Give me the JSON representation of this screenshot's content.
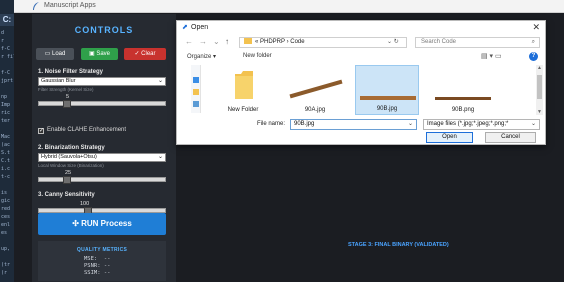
{
  "code_strip": {
    "tab_label": "C:",
    "lines": [
      "d",
      "r",
      "f-C",
      "r fil",
      "",
      "f-C",
      "jprt",
      "",
      "np",
      "Imp",
      "ric",
      "ter",
      "",
      "Mac",
      "(ac",
      "S.t",
      "C.t",
      "i.c",
      "t-c",
      "",
      "is",
      "gic",
      "red",
      "ces",
      "enl",
      "es",
      "",
      "up,",
      "",
      "(tr",
      "(r"
    ]
  },
  "app": {
    "title": "Manuscript Apps",
    "sidebar": {
      "heading": "CONTROLS",
      "buttons": {
        "load": "Load",
        "save": "Save",
        "clear": "Clear"
      },
      "noise": {
        "heading": "1. Noise Filter Strategy",
        "selected": "Gaussian Blur",
        "hint": "Filter Strength (Kernel Size)",
        "value": "5",
        "slider_fraction": 0.2
      },
      "clahe_label": "Enable CLAHE Enhancement",
      "binarization": {
        "heading": "2. Binarization Strategy",
        "selected": "Hybrid (Sauvola+Otsu)",
        "hint": "Local Window Size (Binarization)",
        "value": "25",
        "slider_fraction": 0.2
      },
      "canny": {
        "heading": "3. Canny Sensitivity",
        "value": "100",
        "slider_fraction": 0.38
      },
      "run_label": "RUN Process",
      "metrics": {
        "title": "QUALITY METRICS",
        "mse": "MSE:  --",
        "psnr": "PSNR: --",
        "ssim": "SSIM: --"
      }
    },
    "stage_label": "STAGE 3: FINAL BINARY (VALIDATED)"
  },
  "dialog": {
    "title": "Open",
    "breadcrumb": "«  PHDPRP  ›  Code",
    "search_placeholder": "Search Code",
    "organize": "Organize ▾",
    "new_folder": "New folder",
    "files": [
      {
        "name": "New Folder",
        "kind": "folder"
      },
      {
        "name": "90A.jpg",
        "kind": "image"
      },
      {
        "name": "90B.jpg",
        "kind": "image",
        "selected": true
      },
      {
        "name": "90B.png",
        "kind": "image"
      }
    ],
    "file_name_label": "File name:",
    "file_name_value": "90B.jpg",
    "file_type": "Image files (*.jpg;*.jpeg;*.png;*",
    "open_label": "Open",
    "cancel_label": "Cancel"
  },
  "colors": {
    "accent": "#58b3ff",
    "run": "#1f7ed6",
    "save": "#2fa04a",
    "clear": "#c8322e",
    "selection": "#cce4f7"
  }
}
